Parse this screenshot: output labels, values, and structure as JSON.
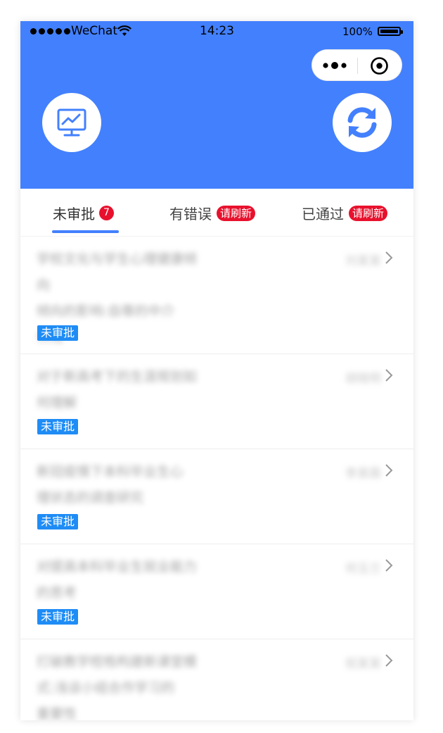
{
  "status_bar": {
    "carrier": "WeChat",
    "time": "14:23",
    "battery": "100%"
  },
  "header": {
    "background_color": "#4380fd",
    "left_button_icon": "monitor-chart-icon",
    "right_button_icon": "refresh-icon",
    "capsule_icons": [
      "more-dots-icon",
      "close-target-icon"
    ]
  },
  "tabs": [
    {
      "label": "未审批",
      "badge": "7",
      "active": true
    },
    {
      "label": "有错误",
      "badge": "请刷新",
      "active": false
    },
    {
      "label": "已通过",
      "badge": "请刷新",
      "active": false
    }
  ],
  "items": [
    {
      "title_lines": [
        "学校文化与学生心理健康倾向",
        "倾向的影响:自尊的中介",
        "作用"
      ],
      "author": "刘某某",
      "status": "未审批"
    },
    {
      "title_lines": [
        "对于新高考下的生涯规划如",
        "何理解"
      ],
      "author": "胡晓明",
      "status": "未审批"
    },
    {
      "title_lines": [
        "新冠疫情下本科毕业生心",
        "理状态的调查研究"
      ],
      "author": "李昊霖",
      "status": "未审批"
    },
    {
      "title_lines": [
        "对提高本科毕业生就业能力",
        "的思考"
      ],
      "author": "何玉兰",
      "status": "未审批"
    },
    {
      "title_lines": [
        "打破教学桎梏构建新课堂模",
        "式:浅谈小组合作学习的",
        "重要性"
      ],
      "author": "祝某某",
      "status": ""
    }
  ],
  "colors": {
    "accent": "#4380fd",
    "badge_red": "#e8112d",
    "status_blue": "#1f8cf5"
  }
}
